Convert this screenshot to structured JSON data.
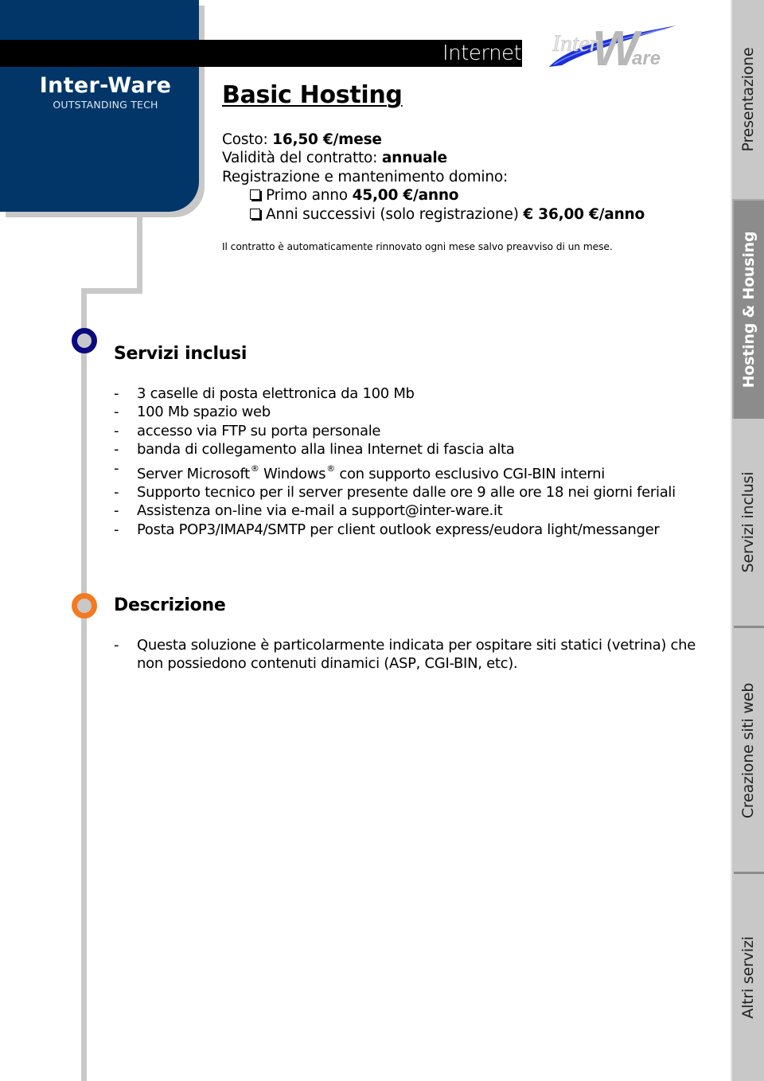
{
  "brand": {
    "name": "Inter-Ware",
    "tagline": "OUTSTANDING TECH",
    "logo_text_light": "Inter",
    "logo_text_big": "W",
    "logo_text_suffix": "are",
    "colors": {
      "panel": "#023668",
      "logo_swoosh": "#1b2fd6",
      "logo_text": "#b8b8b8"
    }
  },
  "header": {
    "section": "Internet"
  },
  "product": {
    "title": "Basic Hosting",
    "cost_label": "Costo: ",
    "cost_value": "16,50 €/mese",
    "validity_label": "Validità del contratto: ",
    "validity_value": "annuale",
    "domain_label": "Registrazione e mantenimento domino:",
    "domain_options": [
      {
        "label": "Primo anno ",
        "value": "45,00 €/anno"
      },
      {
        "label": "Anni successivi (solo registrazione) ",
        "value": "€ 36,00 €/anno"
      }
    ],
    "renewal_note": "Il contratto è automaticamente rinnovato ogni mese salvo preavviso di un mese."
  },
  "services": {
    "title": "Servizi inclusi",
    "items": [
      "3 caselle di posta elettronica da 100 Mb",
      "100 Mb spazio web",
      "accesso via FTP su porta personale",
      "banda di collegamento alla linea Internet di fascia alta",
      {
        "pre": "Server Microsoft",
        "mid": " Windows",
        "post": " con supporto esclusivo CGI-BIN interni",
        "mark": "®"
      },
      "Supporto tecnico per il server presente dalle ore 9 alle ore 18 nei giorni feriali",
      "Assistenza on-line via e-mail a support@inter-ware.it",
      "Posta POP3/IMAP4/SMTP per client outlook express/eudora light/messanger"
    ],
    "bullet_color": "#0a0a80"
  },
  "description": {
    "title": "Descrizione",
    "items": [
      "Questa soluzione è particolarmente indicata per ospitare siti statici (vetrina) che non possiedono contenuti dinamici (ASP, CGI-BIN, etc)."
    ],
    "bullet_color": "#f47920"
  },
  "list_dash": "-",
  "side_nav": {
    "tabs": [
      {
        "label": "Presentazione",
        "active": false
      },
      {
        "label": "Hosting & Housing",
        "active": true
      },
      {
        "label": "Servizi inclusi",
        "active": false
      },
      {
        "label": "Creazione siti web",
        "active": false
      },
      {
        "label": "Altri servizi",
        "active": false
      }
    ]
  }
}
